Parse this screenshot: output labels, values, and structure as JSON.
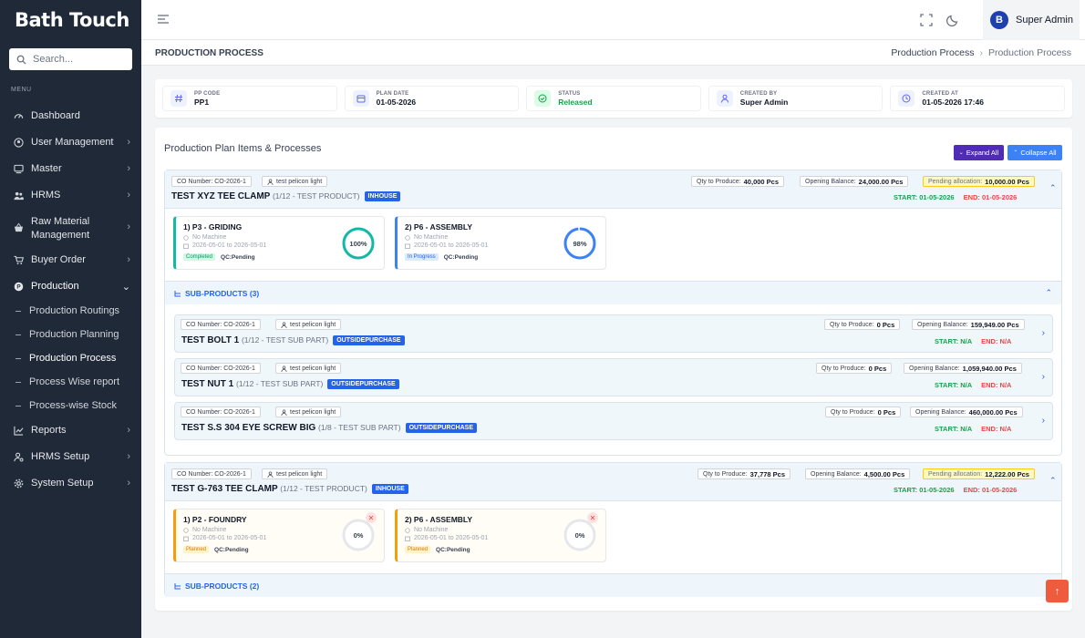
{
  "brand": "Bath Touch",
  "sidebar": {
    "search_placeholder": "Search...",
    "menu_header": "MENU",
    "items": [
      {
        "label": "Dashboard"
      },
      {
        "label": "User Management"
      },
      {
        "label": "Master"
      },
      {
        "label": "HRMS"
      },
      {
        "label": "Raw Material Management"
      },
      {
        "label": "Buyer Order"
      },
      {
        "label": "Production"
      },
      {
        "label": "Reports"
      },
      {
        "label": "HRMS Setup"
      },
      {
        "label": "System Setup"
      }
    ],
    "production_sub": [
      {
        "label": "Production Routings"
      },
      {
        "label": "Production Planning"
      },
      {
        "label": "Production Process"
      },
      {
        "label": "Process Wise report"
      },
      {
        "label": "Process-wise Stock"
      }
    ]
  },
  "topbar": {
    "user_name": "Super Admin",
    "avatar_letter": "B"
  },
  "page": {
    "title": "PRODUCTION PROCESS",
    "breadcrumb": [
      "Production Process",
      "Production Process"
    ]
  },
  "info": [
    {
      "label": "PP CODE",
      "value": "PP1"
    },
    {
      "label": "PLAN DATE",
      "value": "01-05-2026"
    },
    {
      "label": "STATUS",
      "value": "Released"
    },
    {
      "label": "CREATED BY",
      "value": "Super Admin"
    },
    {
      "label": "CREATED AT",
      "value": "01-05-2026 17:46"
    }
  ],
  "section": {
    "title": "Production Plan Items & Processes",
    "expand_all": "Expand All",
    "collapse_all": "Collapse All"
  },
  "colors": {
    "sidebar": "#1f2937",
    "accent": "#2563eb",
    "expand_btn": "#4f2bb8",
    "collapse_btn": "#3b82f6",
    "completed": "#14b8a6",
    "in_progress": "#3b82f6",
    "planned": "#f59e0b"
  },
  "items": [
    {
      "co_number": "CO Number: CO-2026-1",
      "customer": "test pelicon light",
      "name": "TEST XYZ TEE CLAMP",
      "sub": "(1/12 - TEST PRODUCT)",
      "badge": "INHOUSE",
      "qty_label": "Qty to Produce:",
      "qty": "40,000 Pcs",
      "opening_label": "Opening Balance:",
      "opening": "24,000.00 Pcs",
      "pending_label": "Pending allocation:",
      "pending": "10,000.00 Pcs",
      "start": "START: 01-05-2026",
      "end": "END: 01-05-2026",
      "processes": [
        {
          "name": "1) P3 - GRIDING",
          "machine": "No Machine",
          "dates": "2026-05-01 to 2026-05-01",
          "status": "Completed",
          "qc": "QC:Pending",
          "percent": 100,
          "percent_label": "100%"
        },
        {
          "name": "2) P6 - ASSEMBLY",
          "machine": "No Machine",
          "dates": "2026-05-01 to 2026-05-01",
          "status": "In Progress",
          "qc": "QC:Pending",
          "percent": 98,
          "percent_label": "98%"
        }
      ],
      "subproducts_label": "SUB-PRODUCTS (3)",
      "subproducts": [
        {
          "co_number": "CO Number: CO-2026-1",
          "customer": "test pelicon light",
          "name": "TEST BOLT 1",
          "sub": "(1/12 - TEST SUB PART)",
          "badge": "OUTSIDEPURCHASE",
          "qty_label": "Qty to Produce:",
          "qty": "0 Pcs",
          "opening_label": "Opening Balance:",
          "opening": "159,949.00 Pcs",
          "start": "START: N/A",
          "end": "END: N/A"
        },
        {
          "co_number": "CO Number: CO-2026-1",
          "customer": "test pelicon light",
          "name": "TEST NUT 1",
          "sub": "(1/12 - TEST SUB PART)",
          "badge": "OUTSIDEPURCHASE",
          "qty_label": "Qty to Produce:",
          "qty": "0 Pcs",
          "opening_label": "Opening Balance:",
          "opening": "1,059,940.00 Pcs",
          "start": "START: N/A",
          "end": "END: N/A"
        },
        {
          "co_number": "CO Number: CO-2026-1",
          "customer": "test pelicon light",
          "name": "TEST S.S 304 EYE SCREW BIG",
          "sub": "(1/8 - TEST SUB PART)",
          "badge": "OUTSIDEPURCHASE",
          "qty_label": "Qty to Produce:",
          "qty": "0 Pcs",
          "opening_label": "Opening Balance:",
          "opening": "460,000.00 Pcs",
          "start": "START: N/A",
          "end": "END: N/A"
        }
      ]
    },
    {
      "co_number": "CO Number: CO-2026-1",
      "customer": "test pelicon light",
      "name": "TEST G-763 TEE CLAMP",
      "sub": "(1/12 - TEST PRODUCT)",
      "badge": "INHOUSE",
      "qty_label": "Qty to Produce:",
      "qty": "37,778 Pcs",
      "opening_label": "Opening Balance:",
      "opening": "4,500.00 Pcs",
      "pending_label": "Pending allocation:",
      "pending": "12,222.00 Pcs",
      "start": "START: 01-05-2026",
      "end": "END: 01-05-2026",
      "processes": [
        {
          "name": "1) P2 - FOUNDRY",
          "machine": "No Machine",
          "dates": "2026-05-01 to 2026-05-01",
          "status": "Planned",
          "qc": "QC:Pending",
          "percent": 0,
          "percent_label": "0%"
        },
        {
          "name": "2) P6 - ASSEMBLY",
          "machine": "No Machine",
          "dates": "2026-05-01 to 2026-05-01",
          "status": "Planned",
          "qc": "QC:Pending",
          "percent": 0,
          "percent_label": "0%"
        }
      ],
      "subproducts_label": "SUB-PRODUCTS (2)"
    }
  ]
}
